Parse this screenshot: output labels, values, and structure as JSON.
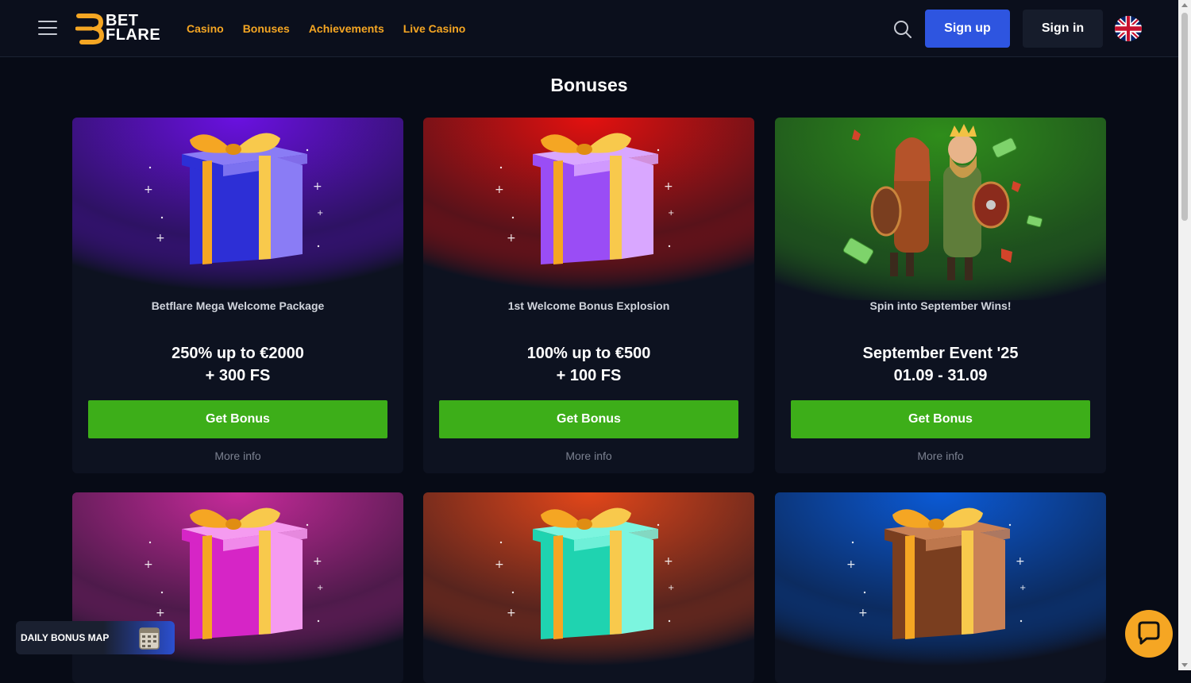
{
  "header": {
    "logo_line1": "BET",
    "logo_line2": "FLARE",
    "nav": [
      "Casino",
      "Bonuses",
      "Achievements",
      "Live Casino"
    ],
    "signup_label": "Sign up",
    "signin_label": "Sign in",
    "language_icon": "uk-flag-icon"
  },
  "page": {
    "title": "Bonuses"
  },
  "cards": [
    {
      "subtitle": "Betflare Mega Welcome Package",
      "offer_line1": "250% up to €2000",
      "offer_line2": "+ 300 FS",
      "button": "Get Bonus",
      "more": "More info",
      "bg_color": "#6a11e0",
      "gift_box": "#2d2fd6",
      "gift_lid": "#8a7cf5"
    },
    {
      "subtitle": "1st Welcome Bonus Explosion",
      "offer_line1": "100% up to €500",
      "offer_line2": "+ 100 FS",
      "button": "Get Bonus",
      "more": "More info",
      "bg_color": "#e3110f",
      "gift_box": "#9a4df5",
      "gift_lid": "#d9a7ff"
    },
    {
      "subtitle": "Spin into September Wins!",
      "offer_line1": "September Event '25",
      "offer_line2": "01.09 - 31.09",
      "button": "Get Bonus",
      "more": "More info",
      "bg_color": "#2f8d1b"
    },
    {
      "bg_color": "#c62a9a",
      "gift_box": "#d625c6",
      "gift_lid": "#f59bf0"
    },
    {
      "bg_color": "#e2461a",
      "gift_box": "#1fd3b0",
      "gift_lid": "#7cf5df"
    },
    {
      "bg_color": "#0b5ad6",
      "gift_box": "#7a3e1f",
      "gift_lid": "#c98156"
    }
  ],
  "widgets": {
    "daily_bonus_map": "DAILY BONUS MAP",
    "chat_icon": "chat-bubble-icon"
  },
  "colors": {
    "accent": "#f5a623",
    "signup": "#2e55e0",
    "bonus_button": "#3dae19",
    "background": "#070b16"
  }
}
